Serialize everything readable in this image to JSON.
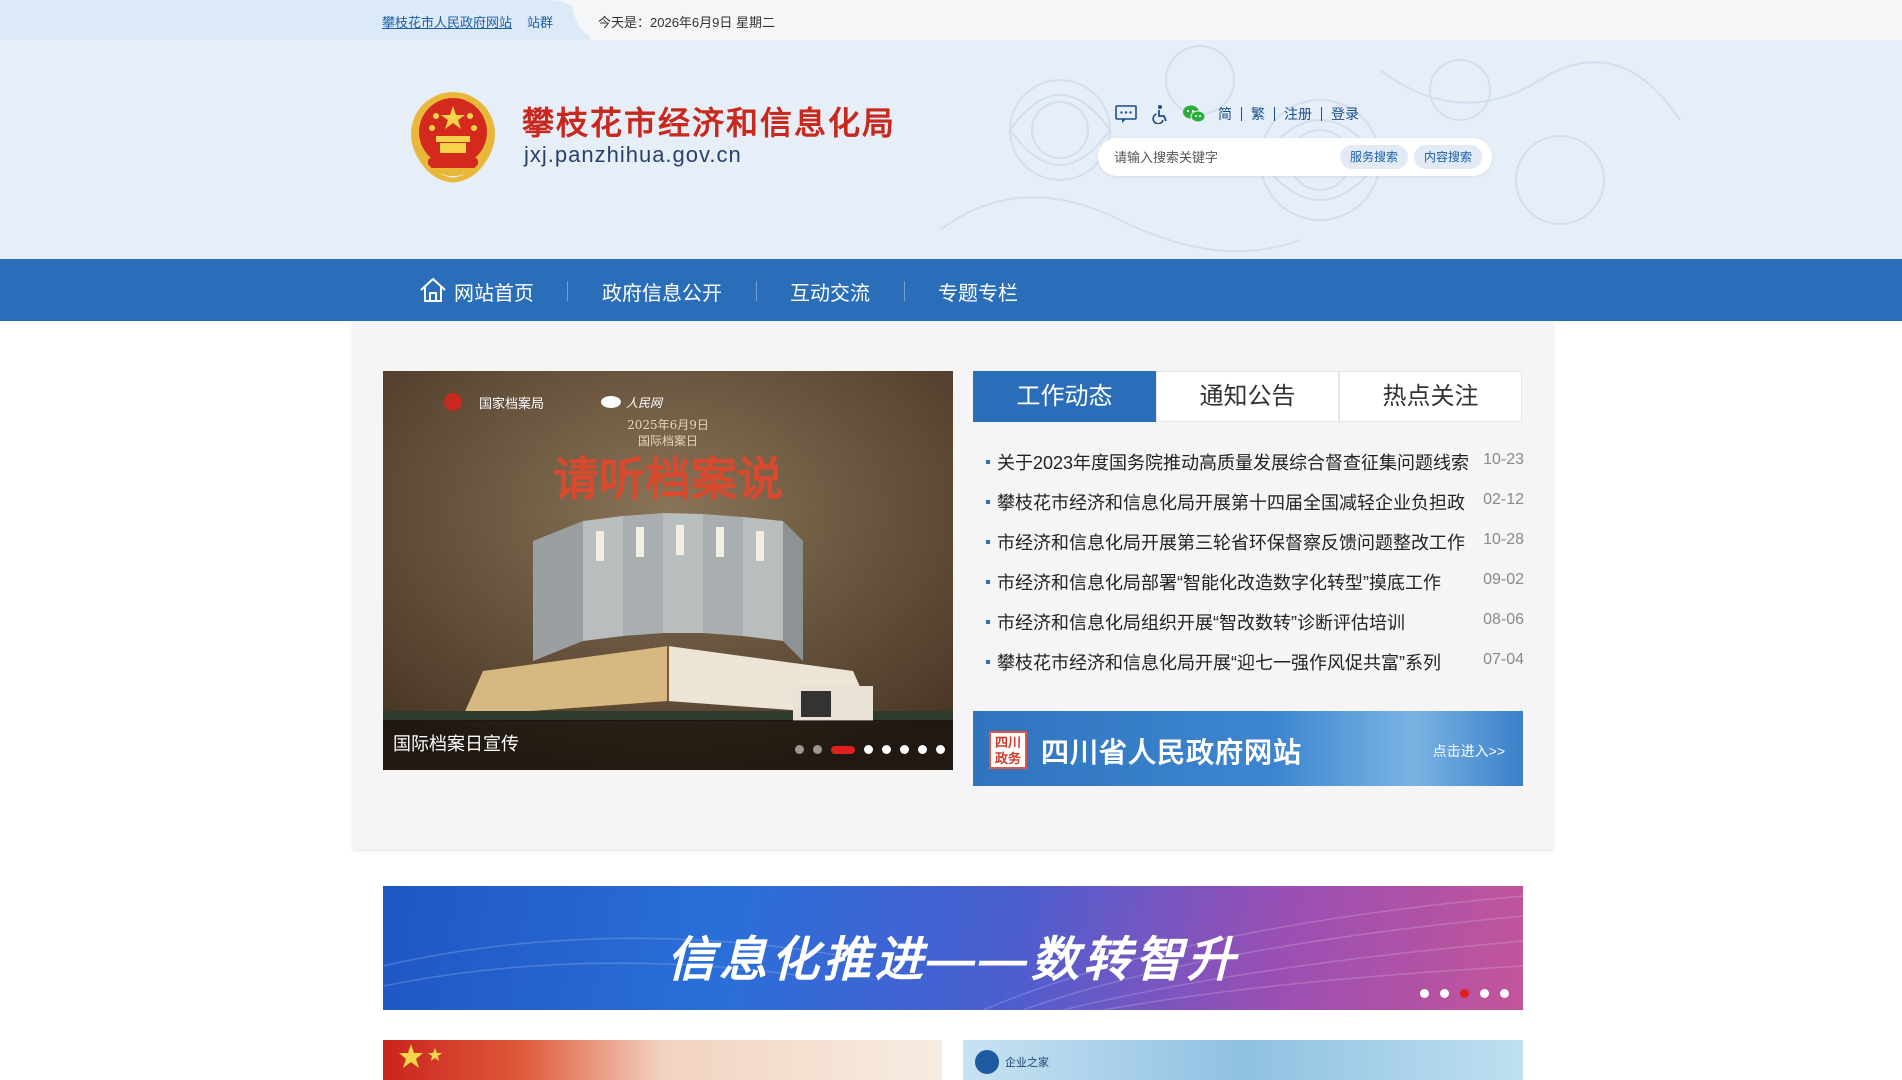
{
  "topbar": {
    "site_link": "攀枝花市人民政府网站",
    "site_group": "站群",
    "date": "今天是：2026年6月9日 星期二"
  },
  "header": {
    "title": "攀枝花市经济和信息化局",
    "domain": "jxj.panzhihua.gov.cn",
    "tools": {
      "icons": [
        "message-icon",
        "accessibility-icon",
        "wechat-icon"
      ],
      "simplified": "简",
      "traditional": "繁",
      "register": "注册",
      "login": "登录"
    },
    "search": {
      "placeholder": "请输入搜索关键字",
      "service_search": "服务搜索",
      "content_search": "内容搜索"
    }
  },
  "nav": {
    "items": [
      "网站首页",
      "政府信息公开",
      "互动交流",
      "专题专栏"
    ]
  },
  "slider": {
    "caption": "国际档案日宣传",
    "image_lines": {
      "logos": "国家档案局",
      "logo2": "人民网",
      "date": "2025年6月9日",
      "event": "国际档案日",
      "headline": "请听档案说"
    }
  },
  "tabs": [
    "工作动态",
    "通知公告",
    "热点关注"
  ],
  "news": [
    {
      "title": "关于2023年度国务院推动高质量发展综合督查征集问题线索",
      "date": "10-23"
    },
    {
      "title": "攀枝花市经济和信息化局开展第十四届全国减轻企业负担政",
      "date": "02-12"
    },
    {
      "title": "市经济和信息化局开展第三轮省环保督察反馈问题整改工作",
      "date": "10-28"
    },
    {
      "title": "市经济和信息化局部署“智能化改造数字化转型”摸底工作",
      "date": "09-02"
    },
    {
      "title": "市经济和信息化局组织开展“智改数转”诊断评估培训",
      "date": "08-06"
    },
    {
      "title": "攀枝花市经济和信息化局开展“迎七一强作风促共富”系列",
      "date": "07-04"
    }
  ],
  "sc_banner": {
    "seal": "四川政务",
    "title": "四川省人民政府网站",
    "enter": "点击进入>>"
  },
  "promo": {
    "text": "信息化推进——数转智升"
  },
  "cards": {
    "right_label": "企业之家"
  },
  "colors": {
    "nav_blue": "#2a6eb9",
    "title_red": "#c8281e",
    "active_dot": "#e0201c"
  }
}
